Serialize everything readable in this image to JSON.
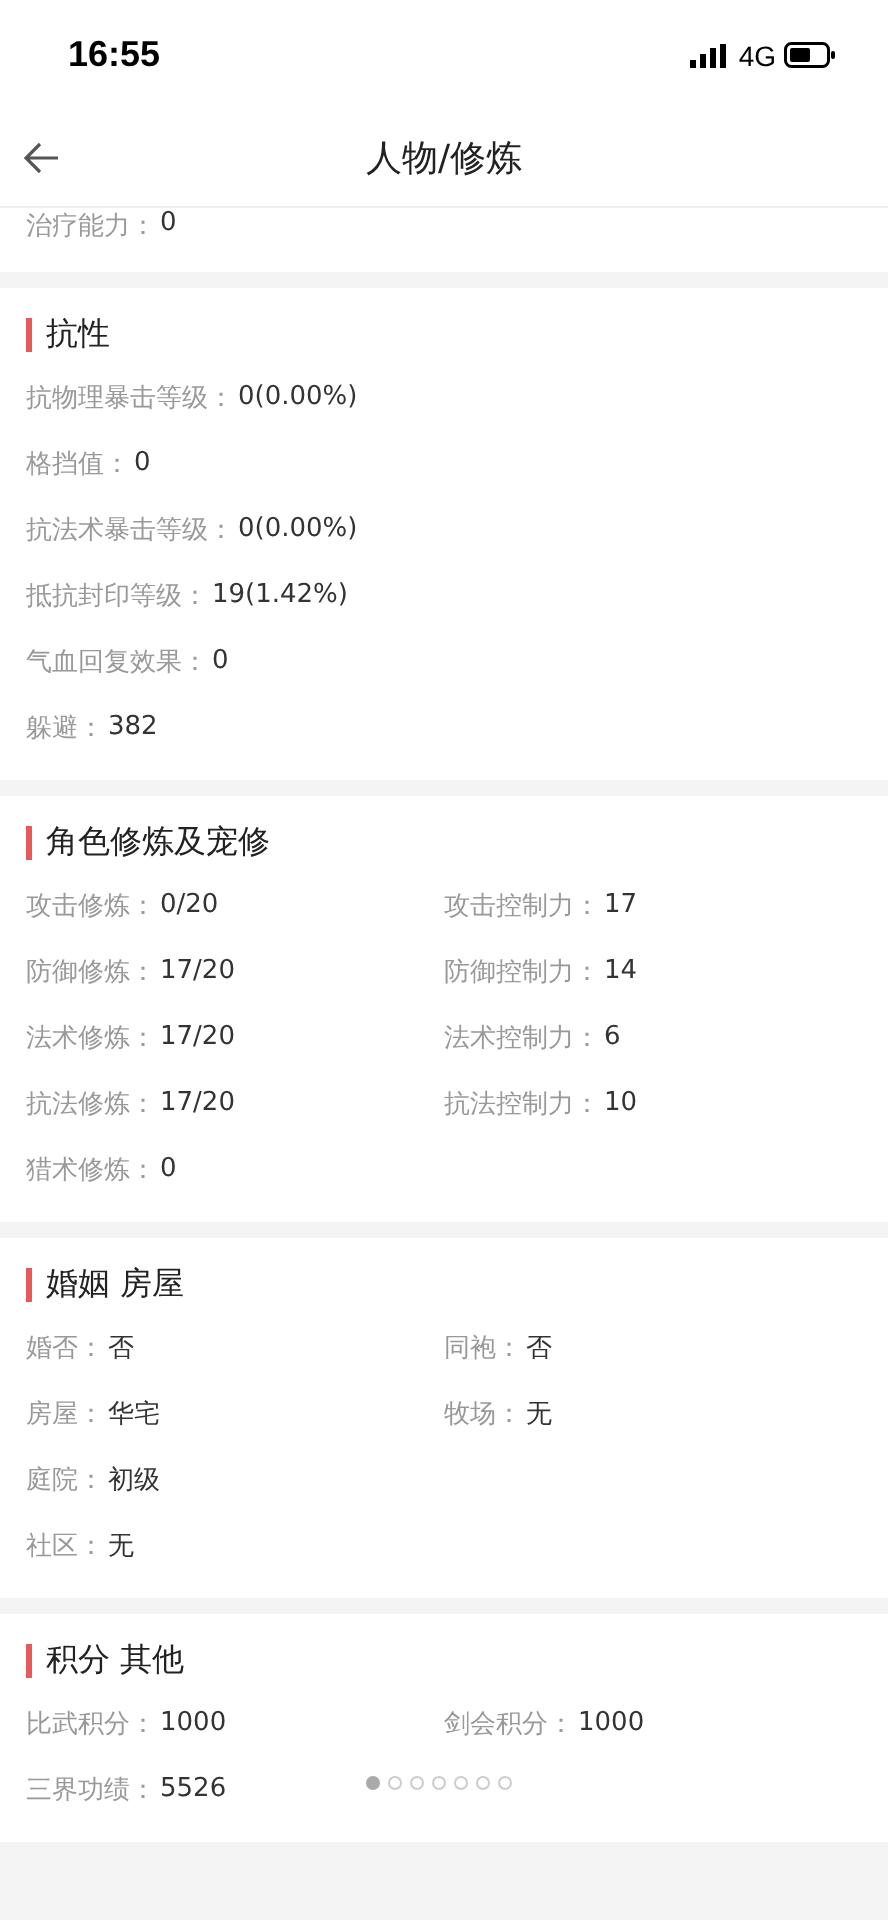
{
  "status_bar": {
    "time": "16:55",
    "network": "4G"
  },
  "nav": {
    "title": "人物/修炼"
  },
  "partial_row": {
    "label": "治疗能力：",
    "value": "0"
  },
  "sections": [
    {
      "title": "抗性",
      "rows": [
        [
          {
            "label": "抗物理暴击等级：",
            "value": "0(0.00%)"
          }
        ],
        [
          {
            "label": "格挡值：",
            "value": "0"
          }
        ],
        [
          {
            "label": "抗法术暴击等级：",
            "value": "0(0.00%)"
          }
        ],
        [
          {
            "label": "抵抗封印等级：",
            "value": "19(1.42%)"
          }
        ],
        [
          {
            "label": "气血回复效果：",
            "value": "0"
          }
        ],
        [
          {
            "label": "躲避：",
            "value": "382"
          }
        ]
      ]
    },
    {
      "title": "角色修炼及宠修",
      "rows": [
        [
          {
            "label": "攻击修炼：",
            "value": "0/20"
          },
          {
            "label": "攻击控制力：",
            "value": "17"
          }
        ],
        [
          {
            "label": "防御修炼：",
            "value": "17/20"
          },
          {
            "label": "防御控制力：",
            "value": "14"
          }
        ],
        [
          {
            "label": "法术修炼：",
            "value": "17/20"
          },
          {
            "label": "法术控制力：",
            "value": "6"
          }
        ],
        [
          {
            "label": "抗法修炼：",
            "value": "17/20"
          },
          {
            "label": "抗法控制力：",
            "value": "10"
          }
        ],
        [
          {
            "label": "猎术修炼：",
            "value": "0"
          }
        ]
      ]
    },
    {
      "title": "婚姻 房屋",
      "rows": [
        [
          {
            "label": "婚否：",
            "value": "否"
          },
          {
            "label": "同袍：",
            "value": "否"
          }
        ],
        [
          {
            "label": "房屋：",
            "value": "华宅"
          },
          {
            "label": "牧场：",
            "value": "无"
          }
        ],
        [
          {
            "label": "庭院：",
            "value": "初级"
          }
        ],
        [
          {
            "label": "社区：",
            "value": "无"
          }
        ]
      ]
    },
    {
      "title": "积分 其他",
      "rows": [
        [
          {
            "label": "比武积分：",
            "value": "1000"
          },
          {
            "label": "剑会积分：",
            "value": "1000"
          }
        ],
        [
          {
            "label": "三界功绩：",
            "value": "5526"
          }
        ]
      ]
    }
  ],
  "pager": [
    {
      "selected": true
    },
    {
      "selected": false
    },
    {
      "selected": false
    },
    {
      "selected": false
    },
    {
      "selected": false
    },
    {
      "selected": false
    },
    {
      "selected": false
    }
  ]
}
